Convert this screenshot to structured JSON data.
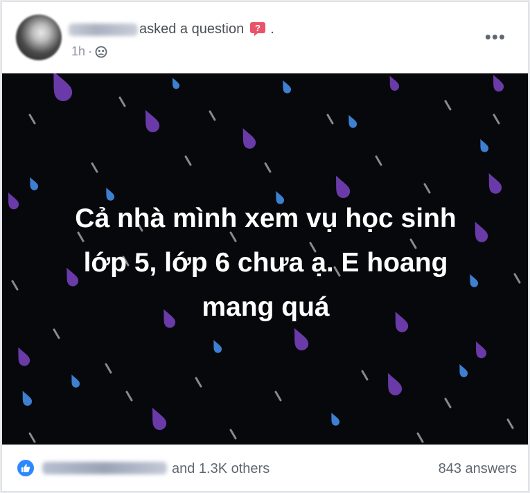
{
  "post": {
    "action_text": "asked a question",
    "trailing_dot": ".",
    "time": "1h",
    "separator": "·",
    "body_text": "Cả nhà mình xem vụ học sinh\nlớp 5, lớp 6 chưa ạ. E hoang\nmang quá",
    "background_color": "#07080b",
    "drop_colors": [
      "#6a3aa8",
      "#3d7fd1",
      "#8a8a8a"
    ]
  },
  "icons": {
    "question": "question-bubble-icon",
    "privacy": "friends-privacy-icon",
    "more": "more-options-icon",
    "like": "like-reaction-icon"
  },
  "footer": {
    "reactions_rest": "and 1.3K others",
    "answers": "843 answers"
  },
  "colors": {
    "like_blue": "#2d88ff",
    "question_red": "#e9536b",
    "muted_text": "#606770"
  }
}
